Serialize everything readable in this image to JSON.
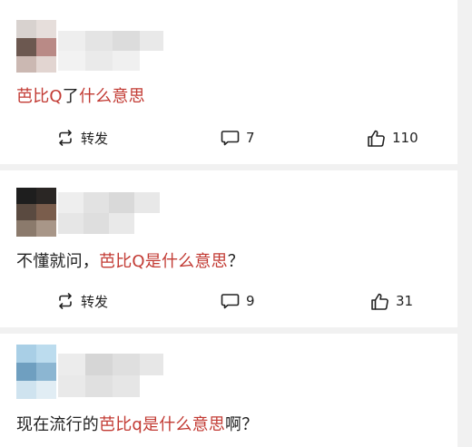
{
  "posts": [
    {
      "text_parts": [
        {
          "t": "芭比Q",
          "hl": true
        },
        {
          "t": "了",
          "hl": false
        },
        {
          "t": "什么意思",
          "hl": true
        }
      ],
      "actions": {
        "repost": "转发",
        "comments": "7",
        "likes": "110"
      }
    },
    {
      "text_parts": [
        {
          "t": "不懂就问，",
          "hl": false
        },
        {
          "t": "芭比Q是什么意思",
          "hl": true
        },
        {
          "t": "？",
          "hl": false
        }
      ],
      "actions": {
        "repost": "转发",
        "comments": "9",
        "likes": "31"
      }
    },
    {
      "text_parts": [
        {
          "t": "现在流行的",
          "hl": false
        },
        {
          "t": "芭比q是什么意思",
          "hl": true
        },
        {
          "t": "啊？",
          "hl": false
        }
      ]
    }
  ],
  "colors": {
    "highlight": "#c23a33",
    "text": "#222222",
    "background": "#f1f1f1"
  }
}
